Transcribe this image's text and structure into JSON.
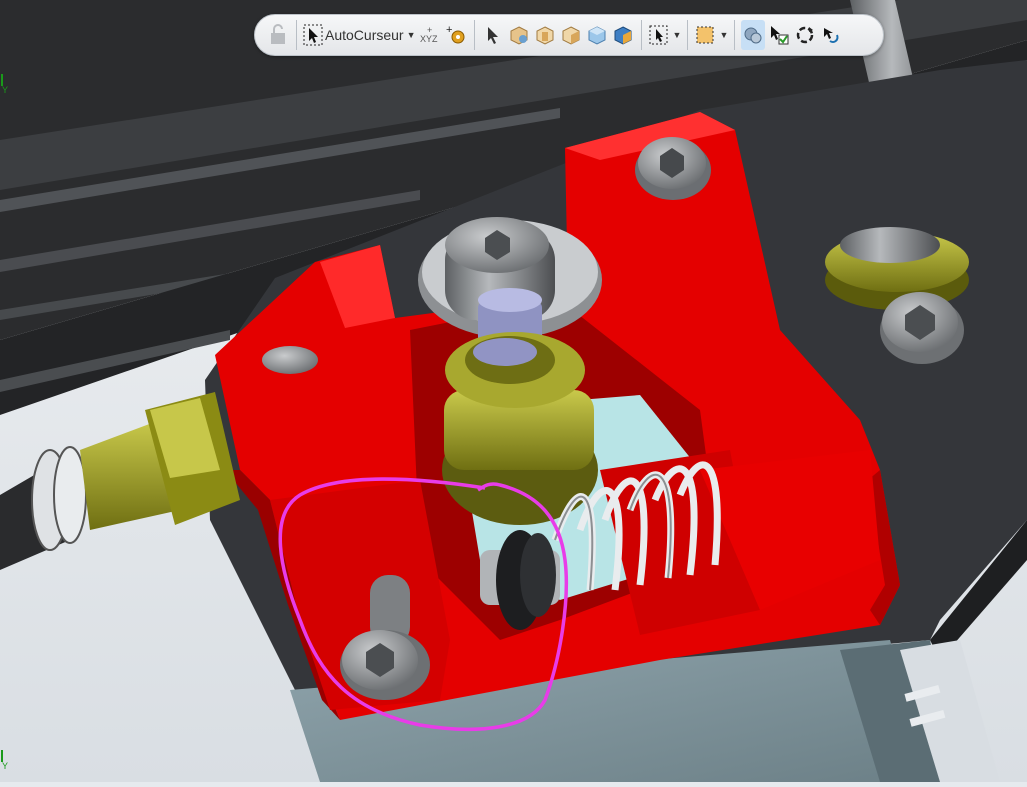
{
  "toolbar": {
    "autocursor_label": "AutoCurseur",
    "items": [
      {
        "name": "lock-icon"
      },
      {
        "name": "autocursor-icon"
      },
      {
        "name": "xyz-axis-icon"
      },
      {
        "name": "add-part-gear-icon"
      },
      {
        "name": "select-arrow-icon"
      },
      {
        "name": "cube-view-iso-icon"
      },
      {
        "name": "cube-view-front-icon"
      },
      {
        "name": "cube-view-side-icon"
      },
      {
        "name": "cube-view-top-icon"
      },
      {
        "name": "cube-view-shaded-icon"
      },
      {
        "name": "selection-filter-icon"
      },
      {
        "name": "box-select-icon"
      },
      {
        "name": "section-view-icon"
      },
      {
        "name": "select-check-icon"
      },
      {
        "name": "rotate-view-icon"
      },
      {
        "name": "undo-view-icon"
      }
    ]
  },
  "scene": {
    "description_colors": {
      "red_part": "#e40000",
      "frame_dark": "#333538",
      "brass": "#9a9a1e",
      "annotation_magenta": "#e83ce8",
      "background": "#e6eaee"
    }
  },
  "axis": {
    "y_label": "Y"
  }
}
